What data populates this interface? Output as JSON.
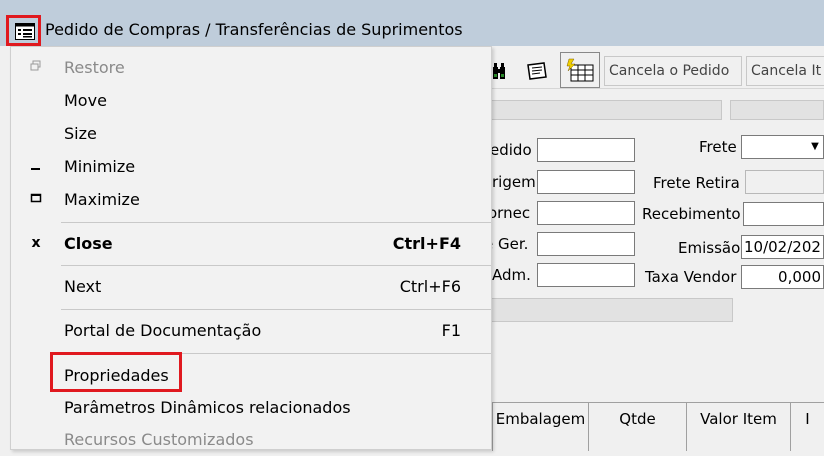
{
  "window": {
    "title": "Pedido de Compras / Transferências de Suprimentos"
  },
  "toolbar": {
    "cancel_order_label": "Cancela o Pedido",
    "cancel_item_label": "Cancela It"
  },
  "form": {
    "pedido_label": "edido",
    "origem_label": "rigem",
    "fornec_label": "ornec",
    "ger_label": "e Ger.",
    "adm_label": "Adm.",
    "frete_label": "Frete",
    "frete_retira_label": "Frete Retira",
    "recebimento_label": "Recebimento",
    "emissao_label": "Emissão",
    "emissao_value": "10/02/202",
    "taxa_vendor_label": "Taxa Vendor",
    "taxa_vendor_value": "0,000"
  },
  "grid": {
    "columns": [
      "Embalagem",
      "Qtde",
      "Valor Item",
      "I"
    ]
  },
  "menu": {
    "restore": "Restore",
    "move": "Move",
    "size": "Size",
    "minimize": "Minimize",
    "maximize": "Maximize",
    "close": "Close",
    "close_shortcut": "Ctrl+F4",
    "next": "Next",
    "next_shortcut": "Ctrl+F6",
    "portal": "Portal de Documentação",
    "portal_shortcut": "F1",
    "propriedades": "Propriedades",
    "parametros": "Parâmetros Dinâmicos relacionados",
    "recursos": "Recursos Customizados"
  },
  "colors": {
    "highlight_box": "#e0191f",
    "titlebar": "#bfcddb"
  }
}
